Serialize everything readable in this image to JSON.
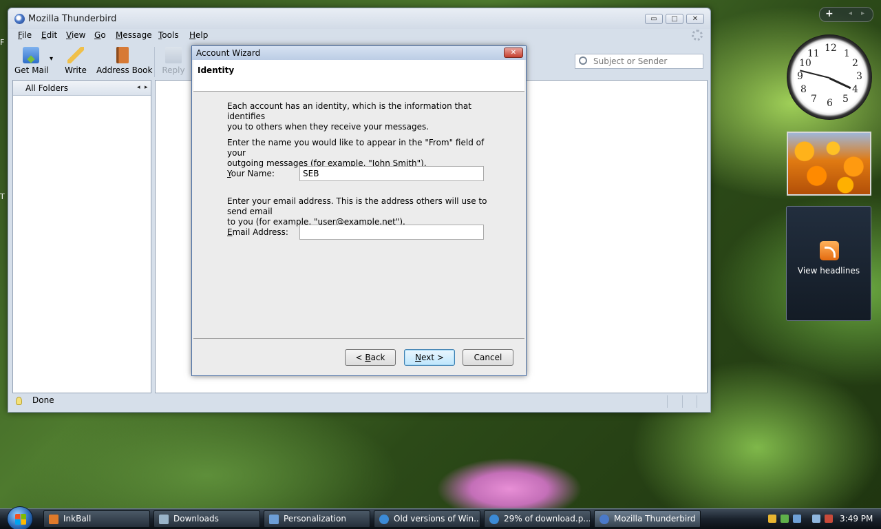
{
  "desktop": {
    "fragment_1": "F",
    "fragment_2": "T"
  },
  "window": {
    "title": "Mozilla Thunderbird",
    "controls": {
      "minimize": "▭",
      "maximize": "□",
      "close": "✕"
    }
  },
  "menu": [
    {
      "pre": "",
      "u": "F",
      "post": "ile"
    },
    {
      "pre": "",
      "u": "E",
      "post": "dit"
    },
    {
      "pre": "",
      "u": "V",
      "post": "iew"
    },
    {
      "pre": "",
      "u": "G",
      "post": "o"
    },
    {
      "pre": "",
      "u": "M",
      "post": "essage"
    },
    {
      "pre": "",
      "u": "T",
      "post": "ools"
    },
    {
      "pre": "",
      "u": "H",
      "post": "elp"
    }
  ],
  "toolbar": {
    "get_mail": "Get Mail",
    "get_mail_dropdown": "▾",
    "write": "Write",
    "address_book": "Address Book",
    "reply": "Reply"
  },
  "search": {
    "placeholder": "Subject or Sender"
  },
  "folders": {
    "header": "All Folders",
    "prev_arrow": "◂",
    "next_arrow": "▸"
  },
  "status": {
    "text": "Done"
  },
  "dialog": {
    "title": "Account Wizard",
    "close": "✕",
    "header": "Identity",
    "intro_line1": "Each account has an identity, which is the information that identifies",
    "intro_line2": "you to others when they receive your messages.",
    "name_help_line1": "Enter the name you would like to appear in the \"From\" field of your",
    "name_help_line2": "outgoing messages (for example, \"John Smith\").",
    "name_label": {
      "u": "Y",
      "rest": "our Name:"
    },
    "name_value": "SEB",
    "email_help_line1": "Enter your email address. This is the address others will use to send email",
    "email_help_line2": "to you (for example, \"user@example.net\").",
    "email_label": {
      "u": "E",
      "rest": "mail Address:"
    },
    "email_value": "",
    "back_button": {
      "pre": "< ",
      "u": "B",
      "post": "ack"
    },
    "next_button": {
      "pre": "",
      "u": "N",
      "post": "ext >"
    },
    "cancel_button": "Cancel"
  },
  "gadgets": {
    "add": "+",
    "prev": "◂",
    "next": "▸",
    "clock_numbers": [
      "12",
      "1",
      "2",
      "3",
      "4",
      "5",
      "6",
      "7",
      "8",
      "9",
      "10",
      "11"
    ],
    "feeds_text": "View headlines"
  },
  "taskbar": {
    "items": [
      {
        "label": "InkBall",
        "color": "#e07a2a"
      },
      {
        "label": "Downloads",
        "color": "#9ab4c9"
      },
      {
        "label": "Personalization",
        "color": "#6d9ed6"
      },
      {
        "label": "Old versions of Win...",
        "color": "#3b8ad6"
      },
      {
        "label": "29% of download.p...",
        "color": "#3b8ad6"
      },
      {
        "label": "Mozilla Thunderbird",
        "color": "#4a79c9"
      }
    ],
    "clock": "3:49 PM"
  }
}
